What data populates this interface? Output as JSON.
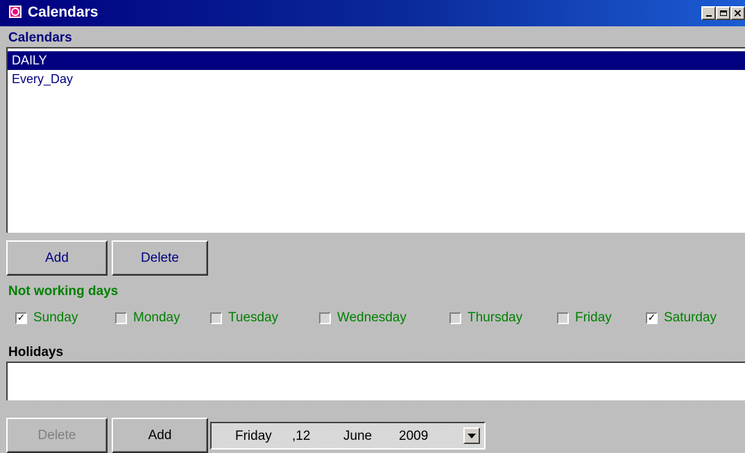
{
  "window": {
    "title": "Calendars"
  },
  "calendars": {
    "label": "Calendars",
    "items": [
      "DAILY",
      "Every_Day"
    ],
    "selected": "DAILY",
    "add_label": "Add",
    "delete_label": "Delete"
  },
  "not_working_days": {
    "label": "Not working days",
    "days": [
      {
        "label": "Sunday",
        "checked": true
      },
      {
        "label": "Monday",
        "checked": false
      },
      {
        "label": "Tuesday",
        "checked": false
      },
      {
        "label": "Wednesday",
        "checked": false
      },
      {
        "label": "Thursday",
        "checked": false
      },
      {
        "label": "Friday",
        "checked": false
      },
      {
        "label": "Saturday",
        "checked": true
      }
    ]
  },
  "holidays": {
    "label": "Holidays",
    "items": [],
    "delete_label": "Delete",
    "add_label": "Add",
    "delete_enabled": false
  },
  "date_picker": {
    "weekday": "Friday",
    "day": ",12",
    "month": "June",
    "year": "2009"
  },
  "colors": {
    "selection": "#000080",
    "calendars_label": "#000080",
    "not_working_label": "#008000",
    "holidays_label": "#000000"
  },
  "icons": {
    "app": "calendar-app-icon",
    "checkbox_checked": "check-mark",
    "dropdown": "chevron-down-icon"
  }
}
